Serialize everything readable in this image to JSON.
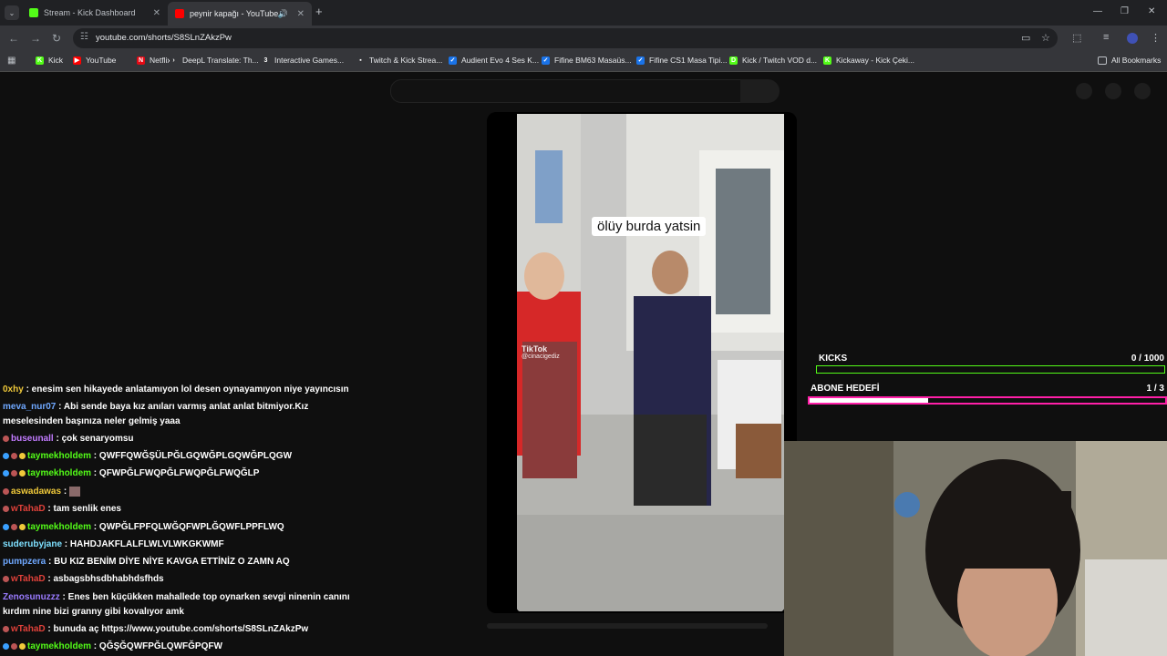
{
  "browser": {
    "tabs": [
      {
        "title": "Stream - Kick Dashboard",
        "favicon_color": "#53fc18",
        "active": false
      },
      {
        "title": "peynir kapağı - YouTube",
        "favicon_color": "#ff0000",
        "active": true
      }
    ],
    "url": "youtube.com/shorts/S8SLnZAkzPw",
    "bookmarks": [
      {
        "label": "Kick",
        "icon_color": "#53fc18",
        "glyph": "K"
      },
      {
        "label": "YouTube",
        "icon_color": "#ff0000",
        "glyph": "▶"
      },
      {
        "label": "Netflix",
        "icon_color": "#e50914",
        "glyph": "N"
      },
      {
        "label": "DeepL Translate: Th...",
        "icon_color": "#35363a",
        "glyph": "›"
      },
      {
        "label": "Interactive Games...",
        "icon_color": "#35363a",
        "glyph": "3"
      },
      {
        "label": "Twitch & Kick Strea...",
        "icon_color": "#35363a",
        "glyph": "▪"
      },
      {
        "label": "Audient Evo 4 Ses K...",
        "icon_color": "#1a73e8",
        "glyph": "✓"
      },
      {
        "label": "Fifine BM63 Masaüs...",
        "icon_color": "#1a73e8",
        "glyph": "✓"
      },
      {
        "label": "Fifine CS1 Masa Tipi...",
        "icon_color": "#1a73e8",
        "glyph": "✓"
      },
      {
        "label": "Kick / Twitch VOD d...",
        "icon_color": "#53fc18",
        "glyph": "D"
      },
      {
        "label": "Kickaway - Kick Çeki...",
        "icon_color": "#53fc18",
        "glyph": "K"
      }
    ],
    "all_bookmarks": "All Bookmarks"
  },
  "video": {
    "caption": "ölüy burda yatsin",
    "watermark": "TikTok",
    "watermark_handle": "@cinacigediz"
  },
  "goals": {
    "kicks": {
      "label": "KICKS",
      "count": "0 / 1000",
      "fraction": 0.0,
      "color": "#53fc18"
    },
    "subs": {
      "label": "ABONE HEDEFİ",
      "count": "1 / 3",
      "fraction": 0.333,
      "color": "#ff1fa8"
    }
  },
  "chat": [
    {
      "user": "0xhy",
      "color": "#f0c93a",
      "text": " : enesim sen hikayede anlatamıyon lol desen oynayamıyon niye yayıncısın",
      "badges": []
    },
    {
      "user": "meva_nur07",
      "color": "#6fa8ff",
      "text": " : Abi sende baya kız anıları varmış anlat anlat bitmiyor.Kız meselesinden başınıza neler gelmiş yaaa",
      "badges": [],
      "wrap": true
    },
    {
      "user": "buseunall",
      "color": "#c27bff",
      "text": " : çok senaryomsu",
      "badges": [
        "#b55"
      ]
    },
    {
      "user": "taymekholdem",
      "color": "#53fc18",
      "text": " : QWFFQWĞŞÜLPĞLGQWĞPLGQWĞPLQGW",
      "badges": [
        "#3aa0ff",
        "#b55",
        "#f0c93a"
      ]
    },
    {
      "user": "taymekholdem",
      "color": "#53fc18",
      "text": " : QFWPĞLFWQPĞLFWQPĞLFWQĞLP",
      "badges": [
        "#3aa0ff",
        "#b55",
        "#f0c93a"
      ]
    },
    {
      "user": "aswadawas",
      "color": "#f0c93a",
      "text": " : ",
      "badges": [
        "#b55"
      ]
    },
    {
      "user": "wTahaD",
      "color": "#e0413a",
      "text": " : tam senlik enes",
      "badges": [
        "#b55"
      ]
    },
    {
      "user": "taymekholdem",
      "color": "#53fc18",
      "text": " : QWPĞLFPFQLWĞQFWPLĞQWFLPPFLWQ",
      "badges": [
        "#3aa0ff",
        "#b55",
        "#f0c93a"
      ]
    },
    {
      "user": "suderubyjane",
      "color": "#7ee0ff",
      "text": " : HAHDJAKFLALFLWLVLWKGKWMF",
      "badges": []
    },
    {
      "user": "pumpzera",
      "color": "#6fa8ff",
      "text": " : BU KIZ BENİM DİYE NİYE KAVGA ETTİNİZ O ZAMN AQ",
      "badges": []
    },
    {
      "user": "wTahaD",
      "color": "#e0413a",
      "text": " : asbagsbhsdbhabhdsfhds",
      "badges": [
        "#b55"
      ]
    },
    {
      "user": "Zenosunuzzz",
      "color": "#9a7bff",
      "text": " : Enes ben küçükken mahallede top oynarken sevgi ninenin canını kırdım nine bizi granny gibi kovalıyor amk",
      "badges": [],
      "wrap": true
    },
    {
      "user": "wTahaD",
      "color": "#e0413a",
      "text": " : bunuda aç https://www.youtube.com/shorts/S8SLnZAkzPw",
      "badges": [
        "#b55"
      ]
    },
    {
      "user": "taymekholdem",
      "color": "#53fc18",
      "text": " : QĞŞĞQWFPĞLQWFĞPQFW",
      "badges": [
        "#3aa0ff",
        "#b55",
        "#f0c93a"
      ]
    }
  ]
}
